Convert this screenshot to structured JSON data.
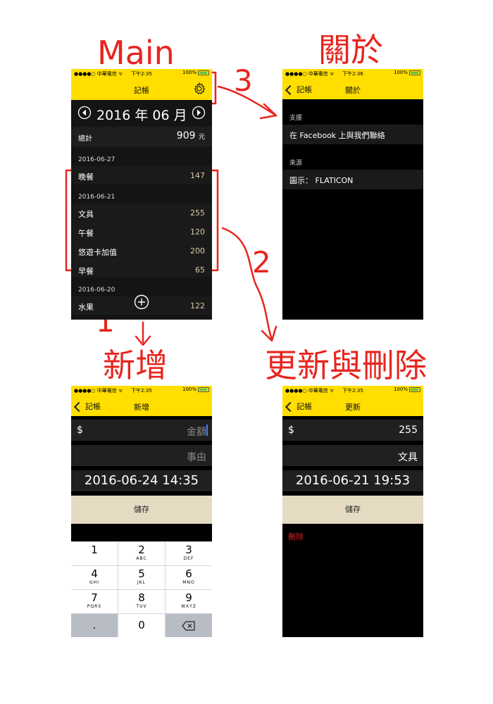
{
  "titles": {
    "main": "Main",
    "about": "關於",
    "add": "新增",
    "update_delete": "更新與刪除"
  },
  "steps": [
    "1",
    "2",
    "3"
  ],
  "colors": {
    "accent_yellow": "#ffde00",
    "annotation_red": "#e8241d",
    "amount_tan": "#d8cba8",
    "save_bg": "#e5dbc3",
    "delete_red": "#e02020"
  },
  "status": {
    "carrier": "●●●●○ 中華電信 ᯤ",
    "battery": "100%",
    "time_main": "下午2:35",
    "time_about": "下午2:36"
  },
  "main_screen": {
    "nav_title": "記帳",
    "settings_icon": "gear-icon",
    "month_label": "2016 年 06 月",
    "total_label": "總計",
    "total_value": "909",
    "total_unit": "元",
    "groups": [
      {
        "date": "2016-06-27",
        "items": [
          {
            "label": "晚餐",
            "amount": "147"
          }
        ]
      },
      {
        "date": "2016-06-21",
        "items": [
          {
            "label": "文具",
            "amount": "255"
          },
          {
            "label": "午餐",
            "amount": "120"
          },
          {
            "label": "悠遊卡加值",
            "amount": "200"
          },
          {
            "label": "早餐",
            "amount": "65"
          }
        ]
      },
      {
        "date": "2016-06-20",
        "items": [
          {
            "label": "水果",
            "amount": "122"
          }
        ]
      }
    ]
  },
  "about_screen": {
    "back_label": "記帳",
    "nav_title": "關於",
    "support_header": "支援",
    "support_item": "在 Facebook 上與我們聯絡",
    "source_header": "來源",
    "source_item": "圖示： FLATICON"
  },
  "add_screen": {
    "back_label": "記帳",
    "nav_title": "新增",
    "currency": "$",
    "amount_placeholder": "金額",
    "reason_placeholder": "事由",
    "datetime": "2016-06-24 14:35",
    "save_label": "儲存",
    "keypad": [
      {
        "digit": "1",
        "letters": ""
      },
      {
        "digit": "2",
        "letters": "ABC"
      },
      {
        "digit": "3",
        "letters": "DEF"
      },
      {
        "digit": "4",
        "letters": "GHI"
      },
      {
        "digit": "5",
        "letters": "JKL"
      },
      {
        "digit": "6",
        "letters": "MNO"
      },
      {
        "digit": "7",
        "letters": "PQRS"
      },
      {
        "digit": "8",
        "letters": "TUV"
      },
      {
        "digit": "9",
        "letters": "WXYZ"
      }
    ],
    "dot_key": ".",
    "zero_key": "0"
  },
  "update_screen": {
    "back_label": "記帳",
    "nav_title": "更新",
    "currency": "$",
    "amount": "255",
    "reason": "文具",
    "datetime": "2016-06-21 19:53",
    "save_label": "儲存",
    "delete_label": "刪除"
  }
}
